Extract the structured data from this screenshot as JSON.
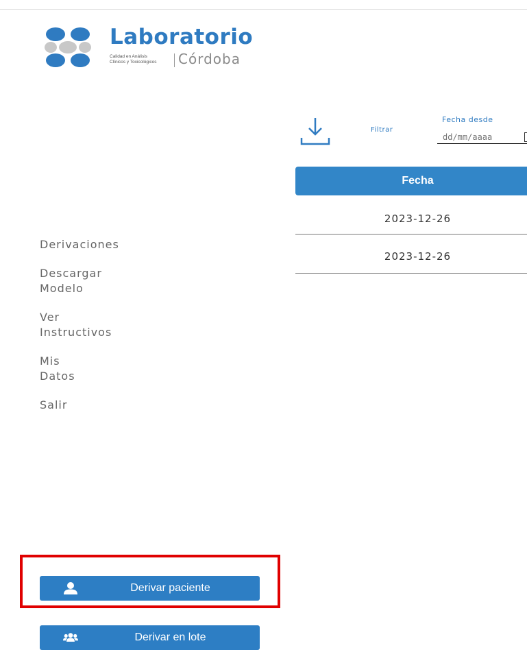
{
  "logo": {
    "title": "Laboratorio",
    "subtitle_line1": "Calidad en Análisis",
    "subtitle_line2": "Clínicos y Toxicológicos",
    "city": "Córdoba",
    "brand_color": "#2f7bc1"
  },
  "sidebar": {
    "items": [
      {
        "label": "Derivaciones"
      },
      {
        "label": "Descargar\nModelo"
      },
      {
        "label": "Ver\nInstructivos"
      },
      {
        "label": "Mis\nDatos"
      },
      {
        "label": "Salir"
      }
    ]
  },
  "actions": {
    "derive_patient": {
      "label": "Derivar paciente",
      "icon": "user-icon"
    },
    "derive_batch": {
      "label": "Derivar en lote",
      "icon": "users-group-icon"
    },
    "button_color": "#2d7ec4",
    "highlight_color": "#e00000"
  },
  "toolbar": {
    "download_icon": "download-icon",
    "filter_label": "Filtrar",
    "date_from_label": "Fecha desde",
    "date_from_placeholder": "dd/mm/aaaa"
  },
  "table": {
    "header_color": "#3286c8",
    "columns": [
      "Fecha"
    ],
    "rows": [
      {
        "fecha": "2023-12-26"
      },
      {
        "fecha": "2023-12-26"
      }
    ]
  }
}
